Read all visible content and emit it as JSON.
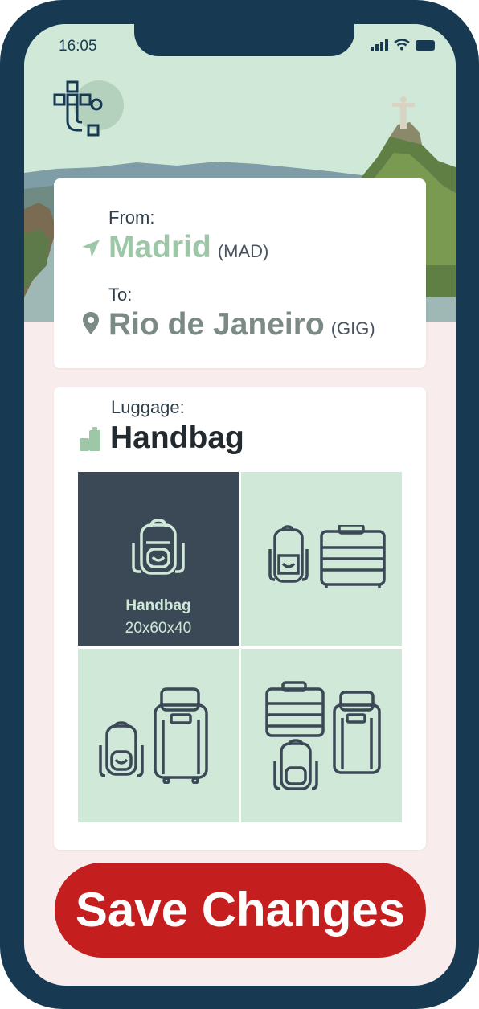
{
  "status_bar": {
    "time": "16:05"
  },
  "route": {
    "from_label": "From:",
    "from_city": "Madrid",
    "from_code": "(MAD)",
    "to_label": "To:",
    "to_city": "Rio de Janeiro",
    "to_code": "(GIG)"
  },
  "luggage": {
    "label": "Luggage:",
    "selected": "Handbag",
    "options": [
      {
        "name": "Handbag",
        "size": "20x60x40",
        "selected": true
      },
      {
        "name": "",
        "size": "",
        "selected": false
      },
      {
        "name": "",
        "size": "",
        "selected": false
      },
      {
        "name": "",
        "size": "",
        "selected": false
      }
    ]
  },
  "save_button": {
    "label": "Save Changes"
  },
  "colors": {
    "frame": "#173a52",
    "hero_bg": "#cfe8d7",
    "accent_green": "#9ec7a8",
    "city_text": "#7b8a84",
    "tile_bg": "#cfe8d7",
    "tile_selected": "#3b4856",
    "save_button": "#c41e1e"
  }
}
